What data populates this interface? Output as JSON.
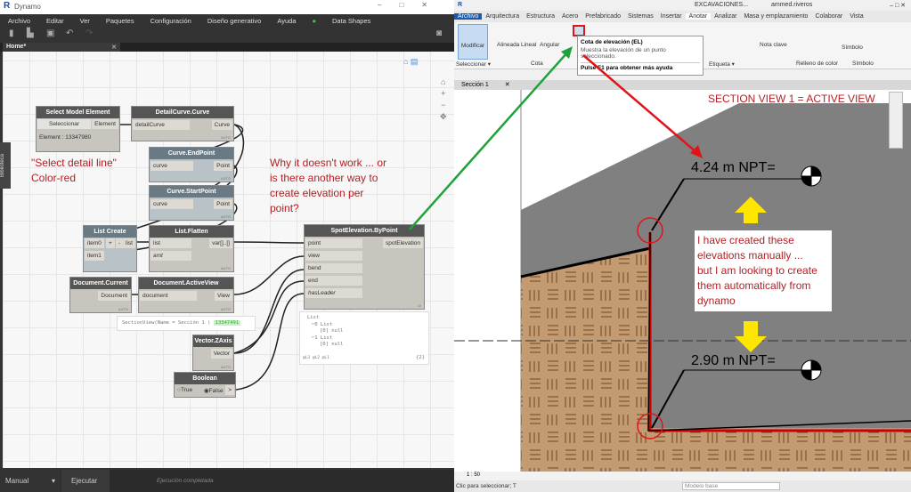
{
  "dynamo": {
    "title": "Dynamo",
    "menu": [
      "Archivo",
      "Editar",
      "Ver",
      "Paquetes",
      "Configuración",
      "Diseño generativo",
      "Ayuda",
      "Data Shapes"
    ],
    "tab": "Home*",
    "library": "Biblioteca",
    "run_mode": "Manual",
    "run_button": "Ejecutar",
    "status": "Ejecución completada",
    "nodes": {
      "select": {
        "title": "Select Model Element",
        "button": "Seleccionar",
        "out": "Element",
        "value": "Element : 13347980"
      },
      "detailcurve": {
        "title": "DetailCurve.Curve",
        "in": "detailCurve",
        "out": "Curve"
      },
      "endpoint": {
        "title": "Curve.EndPoint",
        "in": "curve",
        "out": "Point"
      },
      "startpoint": {
        "title": "Curve.StartPoint",
        "in": "curve",
        "out": "Point"
      },
      "listcreate": {
        "title": "List Create",
        "in0": "item0",
        "in1": "item1",
        "plus": "+",
        "minus": "-",
        "out": "list"
      },
      "flatten": {
        "title": "List.Flatten",
        "in0": "list",
        "in1": "amt",
        "out": "var[]..[]"
      },
      "doccurrent": {
        "title": "Document.Current",
        "out": "Document"
      },
      "activeview": {
        "title": "Document.ActiveView",
        "in": "document",
        "out": "View",
        "preview": "SectionView(Name = Sección 1 )",
        "preview_id": "13347491"
      },
      "zaxis": {
        "title": "Vector.ZAxis",
        "out": "Vector"
      },
      "boolean": {
        "title": "Boolean",
        "opt_true": "True",
        "opt_false": "False",
        "out": ">"
      },
      "spot": {
        "title": "SpotElevation.ByPoint",
        "inputs": [
          "point",
          "view",
          "bend",
          "end",
          "hasLeader"
        ],
        "out": "spotElevation",
        "lacing": "l1l"
      },
      "watch": {
        "lines": [
          "List",
          "⌐0 List",
          "[0] null",
          "⌐1 List",
          "[0] null"
        ],
        "footer": "@L3 @L2 @L1",
        "count": "{2}"
      }
    },
    "auto": "AUTO",
    "note1": [
      "\"Select detail line\"",
      "Color-red"
    ],
    "note2": [
      "Why it doesn't work ... or",
      "is there another way to",
      "create elevation per",
      "point?"
    ]
  },
  "revit": {
    "title": "EXCAVACIONES...",
    "user": "ammed.riveros",
    "tabs": [
      "Archivo",
      "Arquitectura",
      "Estructura",
      "Acero",
      "Prefabricado",
      "Sistemas",
      "Insertar",
      "Anotar",
      "Analizar",
      "Masa y emplazamiento",
      "Colaborar",
      "Vista"
    ],
    "active_tab": "Anotar",
    "ribbon": {
      "modify": "Modificar",
      "select": "Seleccionar ▾",
      "dims": [
        "Alineada",
        "Lineal",
        "Angular"
      ],
      "cota": "Cota",
      "etiqueta": "Etiqueta ▾",
      "nota": "Nota clave",
      "relleno": "Relleno de color",
      "simbolo": "Símbolo",
      "simbolo_group": "Símbolo"
    },
    "tooltip": {
      "title": "Cota de elevación (EL)",
      "desc": "Muestra la elevación de un punto seleccionado.",
      "help": "Pulse F1 para obtener más ayuda"
    },
    "view_tab": "Sección 1",
    "active_note": "SECTION VIEW 1 = ACTIVE VIEW",
    "elev1": "4.24 m NPT=",
    "elev2": "2.90 m NPT=",
    "callout": [
      "I have created these",
      "elevations manually ...",
      "but I am looking to create",
      "them automatically from",
      "dynamo"
    ],
    "scale": "1 : 50",
    "status": "Clic para seleccionar; T",
    "model": "Modelo base"
  },
  "colors": {
    "annotation": "#b21f24",
    "arrow_green": "#1fa23a",
    "arrow_red": "#e0151b",
    "yellow": "#ffe600"
  }
}
